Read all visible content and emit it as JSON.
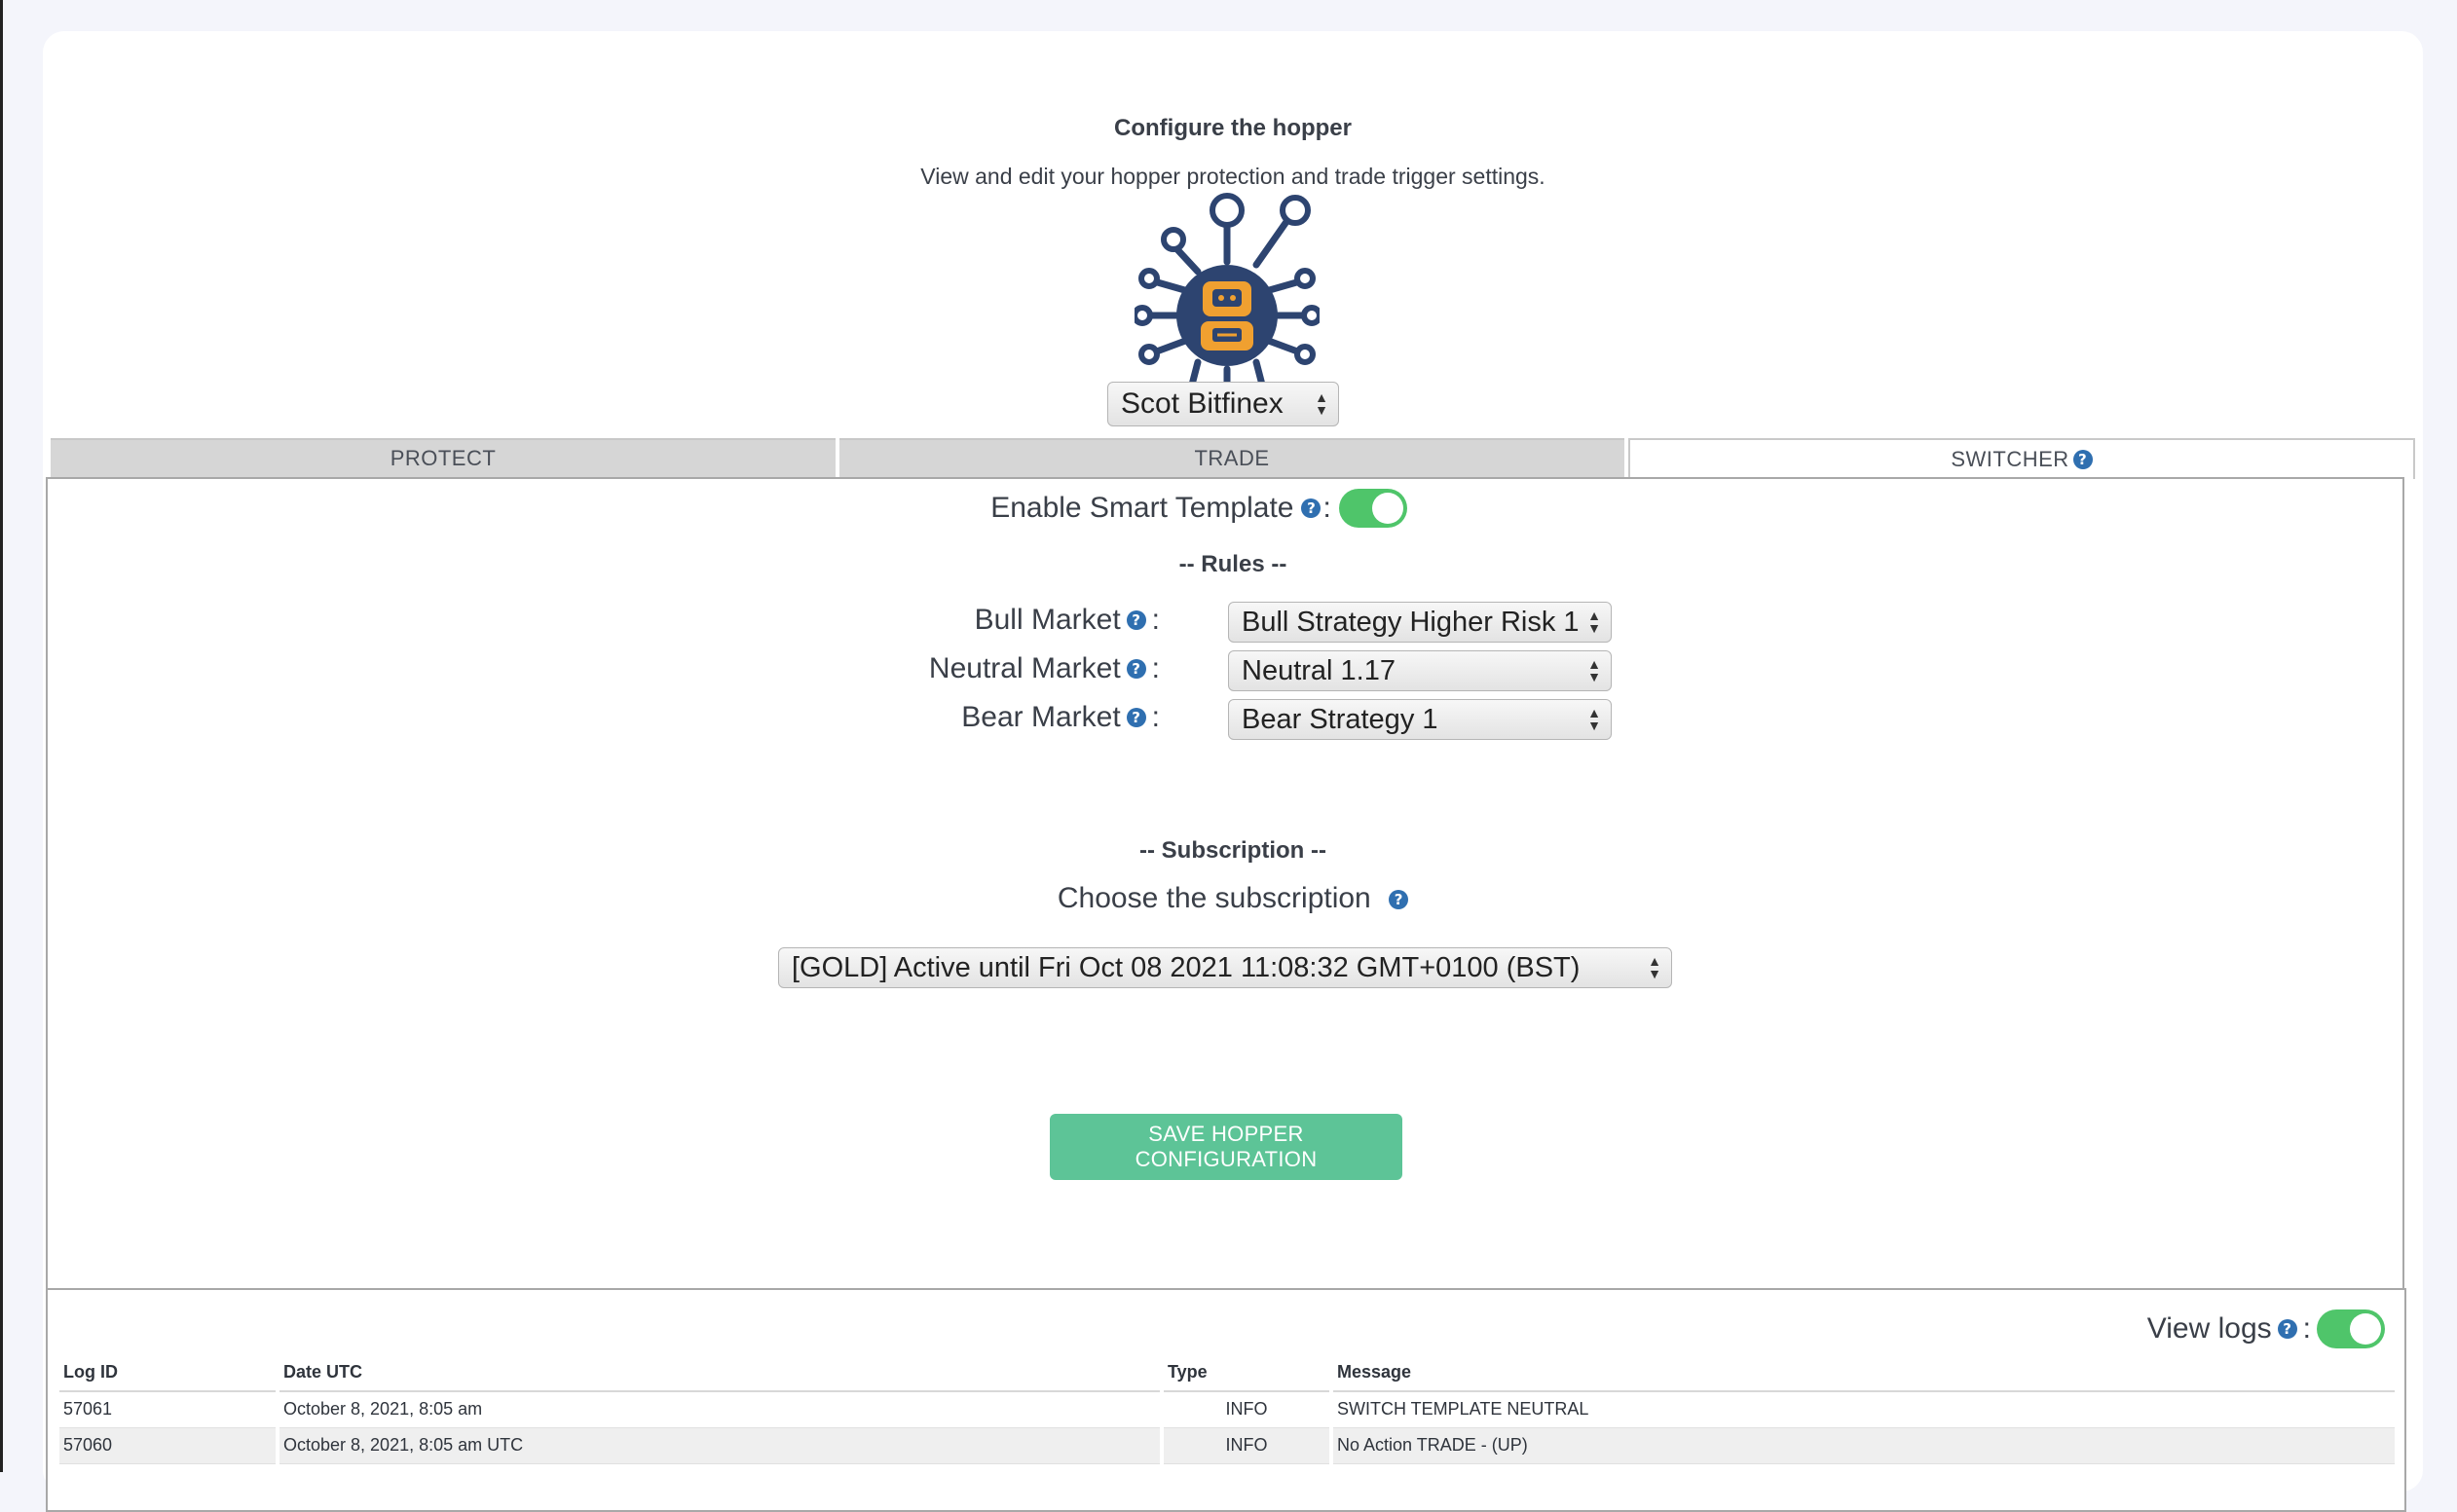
{
  "header": {
    "title": "Configure the hopper",
    "subtitle": "View and edit your hopper protection and trade trigger settings."
  },
  "account_select": {
    "value": "Scot Bitfinex"
  },
  "tabs": [
    {
      "label": "PROTECT",
      "active": false
    },
    {
      "label": "TRADE",
      "active": false
    },
    {
      "label": "SWITCHER",
      "active": true
    }
  ],
  "switcher": {
    "smart_template_label": "Enable Smart Template",
    "smart_template_enabled": true,
    "rules_heading": "-- Rules --",
    "rules": [
      {
        "label": "Bull Market",
        "value": "Bull Strategy Higher Risk 1"
      },
      {
        "label": "Neutral Market",
        "value": "Neutral 1.17"
      },
      {
        "label": "Bear Market",
        "value": "Bear Strategy 1"
      }
    ],
    "subscription_heading": "-- Subscription --",
    "subscription_label": "Choose the subscription",
    "subscription_value": "[GOLD] Active until Fri Oct 08 2021 11:08:32 GMT+0100 (BST)",
    "save_label": "SAVE HOPPER CONFIGURATION"
  },
  "logs": {
    "view_logs_label": "View logs",
    "view_logs_enabled": true,
    "columns": [
      "Log ID",
      "Date UTC",
      "Type",
      "Message"
    ],
    "rows": [
      [
        "57061",
        "October 8, 2021, 8:05 am",
        "INFO",
        "SWITCH TEMPLATE NEUTRAL"
      ],
      [
        "57060",
        "October 8, 2021, 8:05 am UTC",
        "INFO",
        "No Action TRADE - (UP)"
      ]
    ]
  },
  "colors": {
    "accent_green": "#5dc497",
    "toggle_green": "#4fc56a",
    "help_blue": "#2f6fb0",
    "logo_navy": "#2d4470",
    "logo_orange": "#f0a030"
  },
  "icons": {
    "logo": "robot-circuit-logo",
    "help": "question-circle-icon"
  }
}
